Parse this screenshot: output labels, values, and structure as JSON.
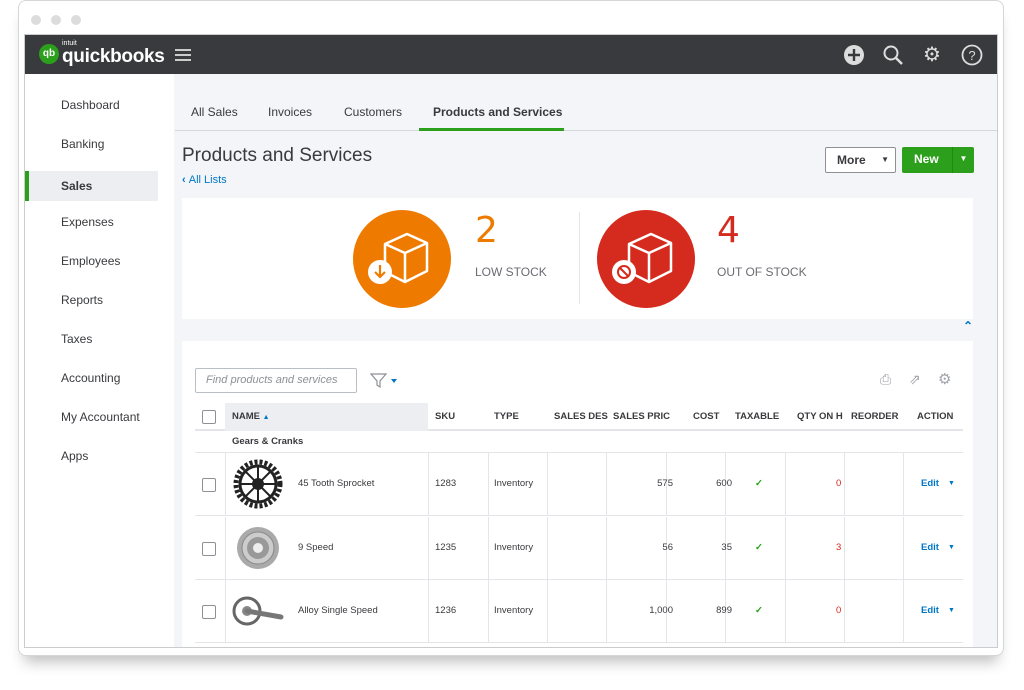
{
  "header": {
    "brand_small": "intuit",
    "brand": "quickbooks",
    "icons": [
      "plus-circle-icon",
      "search-icon",
      "gear-icon",
      "help-icon"
    ]
  },
  "sidebar": {
    "items": [
      {
        "label": "Dashboard"
      },
      {
        "label": "Banking"
      },
      {
        "label": "Sales",
        "selected": true
      },
      {
        "label": "Expenses"
      },
      {
        "label": "Employees"
      },
      {
        "label": "Reports"
      },
      {
        "label": "Taxes"
      },
      {
        "label": "Accounting"
      },
      {
        "label": "My Accountant"
      },
      {
        "label": "Apps"
      }
    ]
  },
  "tabs": [
    {
      "label": "All Sales"
    },
    {
      "label": "Invoices"
    },
    {
      "label": "Customers"
    },
    {
      "label": "Products and Services",
      "active": true
    }
  ],
  "page": {
    "title": "Products and Services",
    "back_link": "All Lists",
    "more_label": "More",
    "new_label": "New"
  },
  "stock": {
    "low": {
      "count": "2",
      "label": "LOW STOCK",
      "color": "#ef7a00"
    },
    "out": {
      "count": "4",
      "label": "OUT OF STOCK",
      "color": "#d52b1e"
    }
  },
  "table": {
    "search_placeholder": "Find products and services",
    "columns": [
      "NAME",
      "SKU",
      "TYPE",
      "SALES DES",
      "SALES PRIC",
      "COST",
      "TAXABLE",
      "QTY ON H",
      "REORDER",
      "ACTION"
    ],
    "group": "Gears & Cranks",
    "rows": [
      {
        "name": "45 Tooth Sprocket",
        "sku": "1283",
        "type": "Inventory",
        "price": "575",
        "cost": "600",
        "taxable": "✓",
        "qty": "0",
        "action": "Edit"
      },
      {
        "name": "9 Speed",
        "sku": "1235",
        "type": "Inventory",
        "price": "56",
        "cost": "35",
        "taxable": "✓",
        "qty": "3",
        "action": "Edit"
      },
      {
        "name": "Alloy Single Speed",
        "sku": "1236",
        "type": "Inventory",
        "price": "1,000",
        "cost": "899",
        "taxable": "✓",
        "qty": "0",
        "action": "Edit"
      }
    ]
  },
  "colors": {
    "accent": "#2ca01c",
    "link": "#0077c5",
    "header": "#393a3d",
    "qty_alert": "#d52b1e"
  }
}
